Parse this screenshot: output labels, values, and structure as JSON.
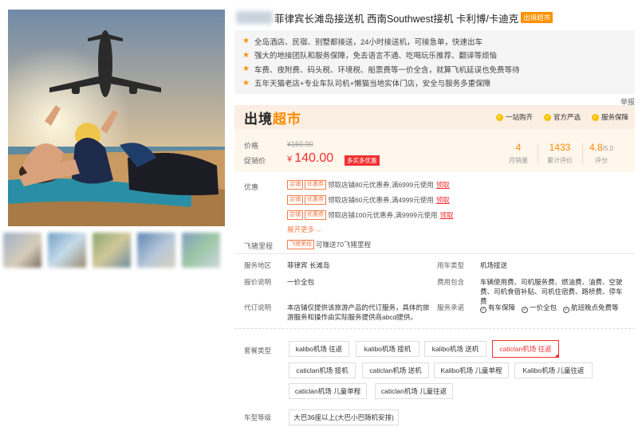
{
  "product": {
    "title": "菲律宾长滩岛接送机 西南Southwest接机 卡利博/卡迪克",
    "badge": "出境超市"
  },
  "features": [
    "全岛酒店、民宿、别墅都接送，24小时接送机，可接急单，快速出车",
    "强大的地接团队和服务保障，免去语言不通、吃喝玩乐推荐、翻译等烦恼",
    "车费、夜附费、码头税、环境税、船票费等一价全含，就算飞机延误也免费等待",
    "五年天猫老店+专业车队司机+懒猫当地实体门店，安全与服务多重保障"
  ],
  "report": "举报",
  "brand": {
    "logo_a": "出境",
    "logo_b": "超市",
    "guarantees": [
      "一站购齐",
      "官方严选",
      "服务保障"
    ]
  },
  "price": {
    "price_label": "价格",
    "original": "¥150.00",
    "promo_label": "促销价",
    "currency": "¥",
    "current": "140.00",
    "discount_badge": "多买多优惠"
  },
  "stats": [
    {
      "value": "4",
      "unit": "",
      "label": "月销量"
    },
    {
      "value": "1433",
      "unit": "",
      "label": "累计评价"
    },
    {
      "value": "4.8",
      "unit": "/5.0",
      "label": "评分"
    }
  ],
  "coupons": {
    "label": "优惠",
    "tag1": "店铺",
    "tag2": "优惠券",
    "claim": "领取",
    "items": [
      "领取店铺80元优惠券,满6999元使用",
      "领取店铺60元优惠券,满4999元使用",
      "领取店铺100元优惠券,满9999元使用"
    ],
    "more": "展开更多 ⌵"
  },
  "miles": {
    "label": "飞猪里程",
    "tag": "飞猪里程",
    "text": "可赚送70飞猪里程"
  },
  "info": {
    "area_label": "服务地区",
    "area_value": "菲律宾  长滩岛",
    "car_type_label": "用车类型",
    "car_type_value": "机场接送",
    "quote_label": "报价说明",
    "quote_value": "一价全包",
    "fee_label": "费用包含",
    "fee_value": "车辆使用费、司机服务费、燃油费、油费、空驶费、司机食宿补贴、司机住宿费、路桥费、停车费",
    "agent_label": "代订说明",
    "agent_value": "本店铺仅提供该旅游产品的代订服务，具体的旅游服务和操作由实际服务提供商abcd提供。",
    "promise_label": "服务承诺",
    "promises": [
      "有车保障",
      "一价全包",
      "航班晚点免费等"
    ]
  },
  "package": {
    "label": "套餐类型",
    "options": [
      "kalibo机场 往返",
      "kalibo机场 接机",
      "kalibo机场 送机",
      "caticlan机场 往返",
      "caticlan机场 接机",
      "caticlan机场 送机",
      "Kalibo机场 儿童单程",
      "Kalibo机场 儿童往返",
      "caticlan机场 儿童单程",
      "caticlan机场 儿童往返"
    ],
    "selected_index": 3
  },
  "vehicle": {
    "label": "车型等级",
    "options": [
      "大巴36座以上(大巴小巴随机安排)"
    ]
  }
}
